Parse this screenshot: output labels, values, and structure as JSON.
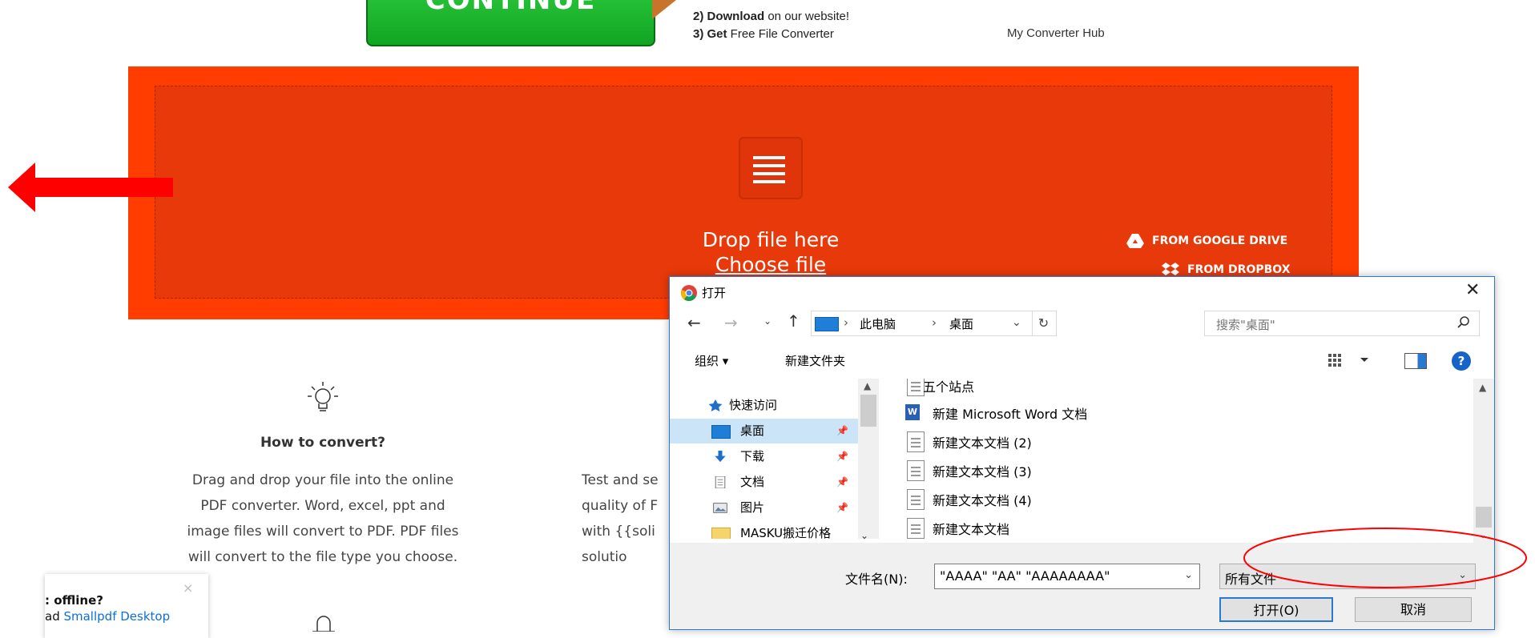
{
  "ad": {
    "button_label": "CONTINUE",
    "steps": [
      {
        "bold": "2) Download",
        "rest": " on our website!"
      },
      {
        "bold": "3) Get",
        "rest": " Free File Converter"
      }
    ],
    "brand": "My Converter Hub"
  },
  "dropzone": {
    "title": "Drop file here",
    "choose_label": "Choose file",
    "google_drive": "FROM GOOGLE DRIVE",
    "dropbox": "FROM DROPBOX",
    "bg_color": "#ff3d00"
  },
  "info": {
    "how_title": "How to convert?",
    "how_lines": [
      "Drag and drop your file into the online",
      "PDF converter. Word, excel, ppt and",
      "image files will convert to PDF. PDF files",
      "will convert to the file type you choose."
    ],
    "test_lines": [
      "Test and se",
      "quality of F",
      "with {{soli",
      "solutio"
    ]
  },
  "toast": {
    "title": ": offline?",
    "line_prefix": "ad ",
    "link": "Smallpdf Desktop",
    "close": "×"
  },
  "dialog": {
    "title": "打开",
    "close": "✕",
    "breadcrumbs": [
      "此电脑",
      "桌面"
    ],
    "search_placeholder": "搜索\"桌面\"",
    "toolbar": {
      "organize": "组织 ▾",
      "new_folder": "新建文件夹"
    },
    "nav": [
      {
        "label": "快速访问",
        "icon": "star-icon"
      },
      {
        "label": "桌面",
        "icon": "desktop-icon",
        "selected": true
      },
      {
        "label": "下载",
        "icon": "download-icon"
      },
      {
        "label": "文档",
        "icon": "document-icon"
      },
      {
        "label": "图片",
        "icon": "picture-icon"
      },
      {
        "label": "MASKU搬迁价格",
        "icon": "folder-icon"
      }
    ],
    "files": [
      {
        "label": "五个站点",
        "icon": "text-file-icon"
      },
      {
        "label": "新建 Microsoft Word 文档",
        "icon": "word-file-icon"
      },
      {
        "label": "新建文本文档 (2)",
        "icon": "text-file-icon"
      },
      {
        "label": "新建文本文档 (3)",
        "icon": "text-file-icon"
      },
      {
        "label": "新建文本文档 (4)",
        "icon": "text-file-icon"
      },
      {
        "label": "新建文本文档",
        "icon": "text-file-icon"
      }
    ],
    "filename_label": "文件名(N):",
    "filename_value": "\"AAAA\" \"AA\" \"AAAAAAAA\"",
    "filter_value": "所有文件",
    "open_label": "打开(O)",
    "cancel_label": "取消"
  },
  "colors": {
    "accent": "#2b78d0",
    "annotation_red": "#ff0000"
  }
}
